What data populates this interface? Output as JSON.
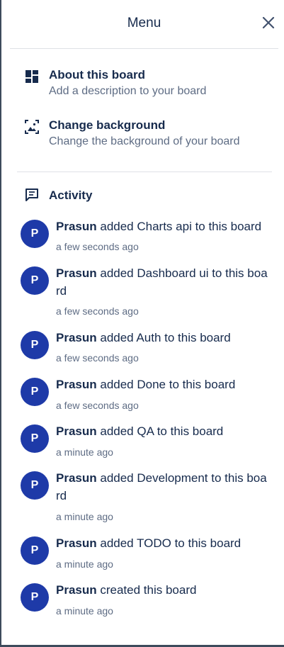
{
  "header": {
    "title": "Menu"
  },
  "sections": [
    {
      "title": "About this board",
      "subtitle": "Add a description to your board",
      "icon": "board-icon"
    },
    {
      "title": "Change background",
      "subtitle": "Change the background of your board",
      "icon": "image-icon"
    }
  ],
  "activity": {
    "title": "Activity",
    "items": [
      {
        "avatar": "P",
        "user": "Prasun",
        "action": " added Charts api to this board",
        "time": "a few seconds ago"
      },
      {
        "avatar": "P",
        "user": "Prasun",
        "action": " added Dashboard ui to this board",
        "time": "a few seconds ago"
      },
      {
        "avatar": "P",
        "user": "Prasun",
        "action": " added Auth to this board",
        "time": "a few seconds ago"
      },
      {
        "avatar": "P",
        "user": "Prasun",
        "action": " added Done to this board",
        "time": "a few seconds ago"
      },
      {
        "avatar": "P",
        "user": "Prasun",
        "action": " added QA to this board",
        "time": "a minute ago"
      },
      {
        "avatar": "P",
        "user": "Prasun",
        "action": " added Development to this board",
        "time": "a minute ago"
      },
      {
        "avatar": "P",
        "user": "Prasun",
        "action": " added TODO to this board",
        "time": "a minute ago"
      },
      {
        "avatar": "P",
        "user": "Prasun",
        "action": " created this board",
        "time": "a minute ago"
      }
    ]
  },
  "colors": {
    "avatar_bg": "#1e3aa8",
    "text": "#172b4d",
    "muted": "#5e6c84"
  }
}
